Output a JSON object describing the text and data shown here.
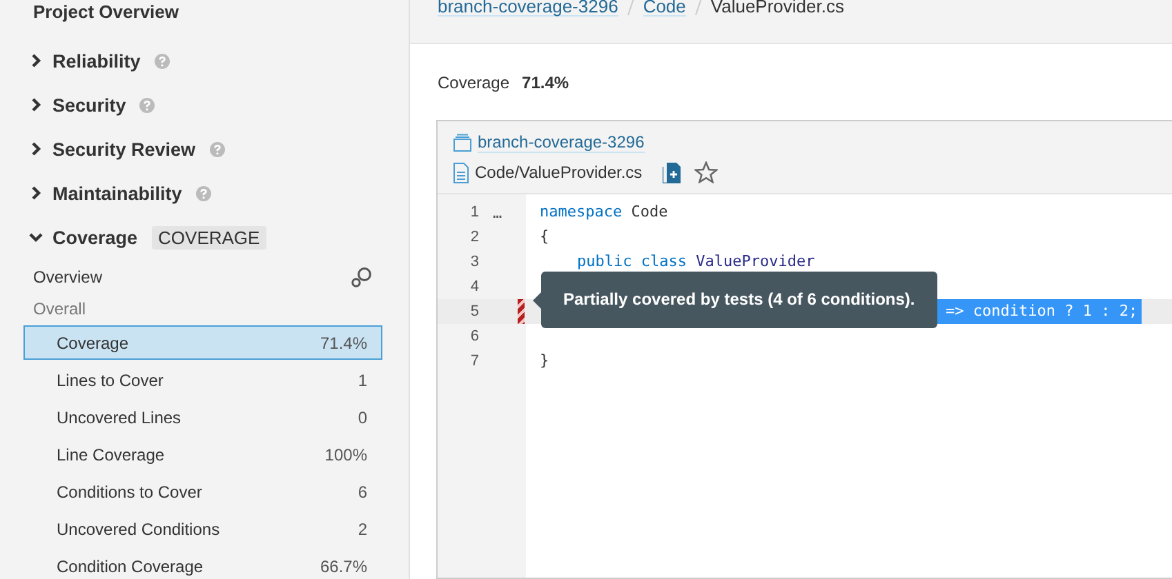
{
  "sidebar": {
    "title": "Project Overview",
    "sections": [
      {
        "label": "Reliability",
        "expanded": false,
        "help": true
      },
      {
        "label": "Security",
        "expanded": false,
        "help": true
      },
      {
        "label": "Security Review",
        "expanded": false,
        "help": true
      },
      {
        "label": "Maintainability",
        "expanded": false,
        "help": true
      },
      {
        "label": "Coverage",
        "expanded": true,
        "help": false,
        "badge": "COVERAGE"
      }
    ],
    "overview_label": "Overview",
    "group_label": "Overall",
    "metrics": [
      {
        "label": "Coverage",
        "value": "71.4%",
        "selected": true
      },
      {
        "label": "Lines to Cover",
        "value": "1",
        "selected": false
      },
      {
        "label": "Uncovered Lines",
        "value": "0",
        "selected": false
      },
      {
        "label": "Line Coverage",
        "value": "100%",
        "selected": false
      },
      {
        "label": "Conditions to Cover",
        "value": "6",
        "selected": false
      },
      {
        "label": "Uncovered Conditions",
        "value": "2",
        "selected": false
      },
      {
        "label": "Condition Coverage",
        "value": "66.7%",
        "selected": false
      }
    ]
  },
  "breadcrumb": [
    {
      "label": "branch-coverage-3296",
      "link": true
    },
    {
      "label": "Code",
      "link": true
    },
    {
      "label": "ValueProvider.cs",
      "link": false
    }
  ],
  "summary": {
    "label": "Coverage",
    "value": "71.4%"
  },
  "viewer": {
    "project": "branch-coverage-3296",
    "file": "Code/ValueProvider.cs",
    "expander": "…",
    "lines": [
      {
        "number": "1",
        "code": [
          {
            "text": "namespace ",
            "kind": "keyword"
          },
          {
            "text": "Code",
            "kind": "plain"
          }
        ],
        "partially_covered": false,
        "selected": false
      },
      {
        "number": "2",
        "code": [
          {
            "text": "{",
            "kind": "plain"
          }
        ],
        "partially_covered": false,
        "selected": false
      },
      {
        "number": "3",
        "indented": true,
        "code": [
          {
            "text": "public ",
            "kind": "keyword"
          },
          {
            "text": "class ",
            "kind": "keyword"
          },
          {
            "text": "ValueProvider",
            "kind": "type"
          }
        ],
        "partially_covered": false,
        "selected": false
      },
      {
        "number": "4",
        "partially_covered": false,
        "selected": false
      },
      {
        "number": "5",
        "code": [
          {
            "text": "=> condition ? 1 : 2;",
            "kind": "selection"
          }
        ],
        "partially_covered": true,
        "selected": true
      },
      {
        "number": "6",
        "partially_covered": false,
        "selected": false
      },
      {
        "number": "7",
        "code": [
          {
            "text": "}",
            "kind": "plain"
          }
        ],
        "partially_covered": false,
        "selected": false
      }
    ],
    "tooltip": "Partially covered by tests (4 of 6 conditions)."
  }
}
